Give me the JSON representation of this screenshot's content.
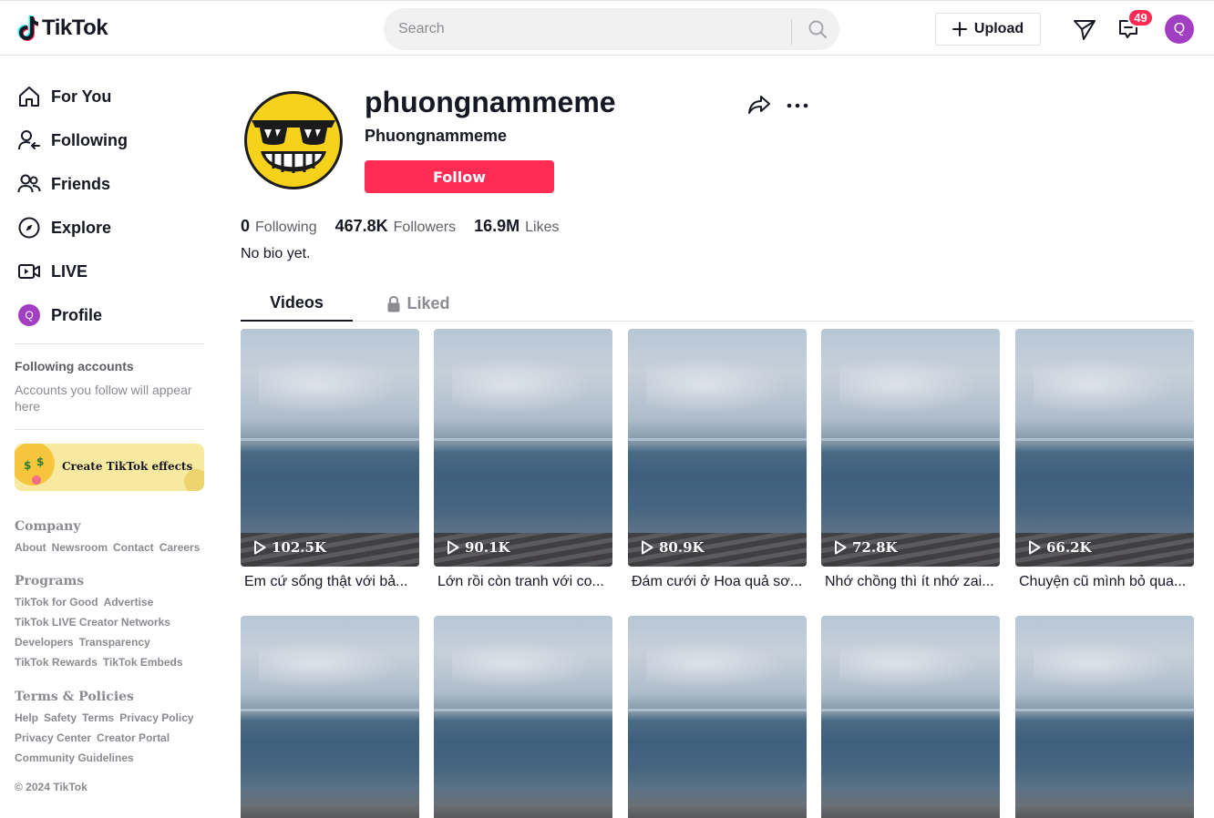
{
  "header": {
    "logo_text": "TikTok",
    "search_placeholder": "Search",
    "upload_label": "Upload",
    "inbox_count": "49",
    "avatar_initial": "Q"
  },
  "sidebar": {
    "nav": [
      {
        "label": "For You",
        "icon": "home-icon"
      },
      {
        "label": "Following",
        "icon": "following-icon"
      },
      {
        "label": "Friends",
        "icon": "friends-icon"
      },
      {
        "label": "Explore",
        "icon": "compass-icon"
      },
      {
        "label": "LIVE",
        "icon": "live-icon"
      },
      {
        "label": "Profile",
        "icon": "avatar",
        "avatar_initial": "Q"
      }
    ],
    "following_heading": "Following accounts",
    "following_note": "Accounts you follow will appear here",
    "effects_label": "Create TikTok effects",
    "footer": {
      "company_title": "Company",
      "company_links": [
        "About",
        "Newsroom",
        "Contact",
        "Careers"
      ],
      "programs_title": "Programs",
      "programs_links": [
        "TikTok for Good",
        "Advertise",
        "TikTok LIVE Creator Networks",
        "Developers",
        "Transparency",
        "TikTok Rewards",
        "TikTok Embeds"
      ],
      "terms_title": "Terms & Policies",
      "terms_links": [
        "Help",
        "Safety",
        "Terms",
        "Privacy Policy",
        "Privacy Center",
        "Creator Portal",
        "Community Guidelines"
      ],
      "copyright": "© 2024 TikTok"
    }
  },
  "profile": {
    "username": "phuongnammeme",
    "nickname": "Phuongnammeme",
    "follow_label": "Follow",
    "stats": {
      "following_count": "0",
      "following_label": "Following",
      "followers_count": "467.8K",
      "followers_label": "Followers",
      "likes_count": "16.9M",
      "likes_label": "Likes"
    },
    "bio": "No bio yet.",
    "tabs": {
      "videos": "Videos",
      "liked": "Liked"
    }
  },
  "videos": [
    {
      "views": "102.5K",
      "caption": "Em cứ sống thật với bả..."
    },
    {
      "views": "90.1K",
      "caption": "Lớn rồi còn tranh với co..."
    },
    {
      "views": "80.9K",
      "caption": "Đám cưới ở Hoa quả sơ..."
    },
    {
      "views": "72.8K",
      "caption": "Nhớ chồng thì ít nhớ zai..."
    },
    {
      "views": "66.2K",
      "caption": "Chuyện cũ mình bỏ qua..."
    }
  ],
  "colors": {
    "accent": "#fe2c55",
    "avatar": "#a23ec1",
    "text": "#161823",
    "muted": "#8a8b91"
  }
}
